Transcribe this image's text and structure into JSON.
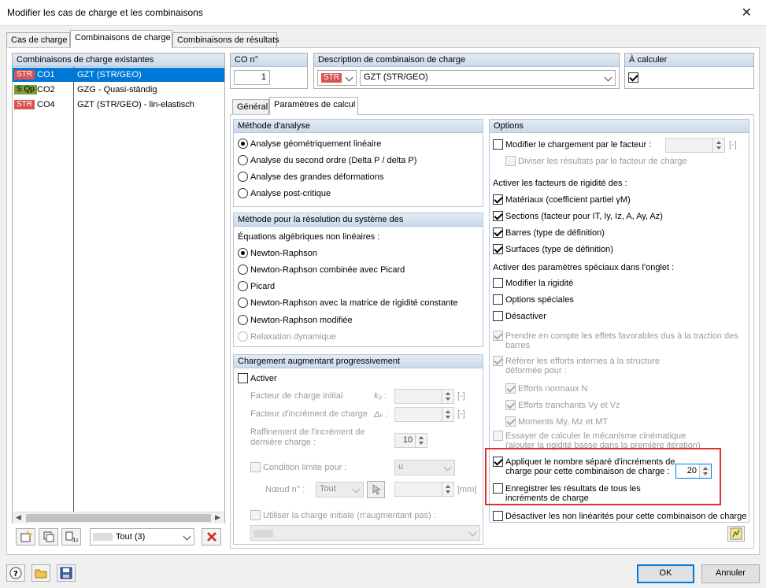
{
  "window": {
    "title": "Modifier les cas de charge et les combinaisons",
    "close": "✕"
  },
  "tabs": [
    "Cas de charge",
    "Combinaisons de charge",
    "Combinaisons de résultats"
  ],
  "colors": {
    "str": "#d9534f",
    "sqp": "#7a9a3a",
    "accent": "#0078d7",
    "highlight": "#e03030"
  },
  "left": {
    "header": "Combinaisons de charge existantes",
    "items": [
      {
        "tag": "STR",
        "id": "CO1",
        "desc": "GZT (STR/GEO)"
      },
      {
        "tag": "S Qp",
        "id": "CO2",
        "desc": "GZG - Quasi-ständig"
      },
      {
        "tag": "STR",
        "id": "CO4",
        "desc": "GZT (STR/GEO) - lin-elastisch"
      }
    ],
    "filter": "Tout (3)"
  },
  "co": {
    "label": "CO n°",
    "value": "1"
  },
  "description": {
    "label": "Description de combinaison de charge",
    "tag": "STR",
    "value": "GZT (STR/GEO)"
  },
  "calc": {
    "label": "À calculer"
  },
  "subtabs": [
    "Général",
    "Paramètres de calcul"
  ],
  "methode": {
    "header": "Méthode d'analyse",
    "options": [
      "Analyse géométriquement linéaire",
      "Analyse du second ordre (Delta P / delta P)",
      "Analyse des grandes déformations",
      "Analyse post-critique"
    ]
  },
  "resolution": {
    "header": "Méthode pour la résolution du système des",
    "sub": "Équations algébriques non linéaires :",
    "options": [
      "Newton-Raphson",
      "Newton-Raphson combinée avec Picard",
      "Picard",
      "Newton-Raphson avec la matrice de rigidité constante",
      "Newton-Raphson modifiée",
      "Relaxation dynamique"
    ]
  },
  "chargement": {
    "header": "Chargement augmentant progressivement",
    "activer": "Activer",
    "facteur_initial": "Facteur de charge initial",
    "k0": "k₀ :",
    "facteur_increment": "Facteur d'incrément de charge",
    "dk": "Δₖ :",
    "raffinement": "Raffinement de l'incrément de",
    "derniere": "dernière charge :",
    "raffinement_value": "10",
    "unit": "[-]",
    "condition": "Condition limite pour :",
    "condition_value": "u",
    "noeud": "Nœud n° :",
    "noeud_value": "Tout",
    "mm": "[mm]",
    "utiliser": "Utiliser la charge initiale (n'augmentant pas) :"
  },
  "options": {
    "header": "Options",
    "modifier": "Modifier le chargement par le facteur :",
    "unit": "[-]",
    "diviser": "Diviser les résultats par le facteur de charge",
    "activer_rigidite": "Activer les facteurs de rigidité des :",
    "materiaux": "Matériaux (coefficient partiel γM)",
    "sections": "Sections (facteur pour IT, Iy, Iz, A, Ay, Az)",
    "barres": "Barres (type de définition)",
    "surfaces": "Surfaces (type de définition)",
    "activer_speciaux": "Activer des paramètres spéciaux dans l'onglet :",
    "modifier_rigidite": "Modifier la rigidité",
    "options_speciales": "Options spéciales",
    "desactiver": "Désactiver",
    "prendre1": "Prendre en compte les effets favorables dus à la traction des",
    "prendre2": "barres",
    "referer1": "Référer les efforts internes à la structure",
    "referer2": "déformée pour :",
    "efforts_normaux": "Efforts normaux N",
    "efforts_tranchants": "Efforts tranchants Vy et Vz",
    "moments": "Moments My, Mz et MT",
    "essayer1": "Essayer de calculer le mécanisme cinématique",
    "essayer2": "(ajouter la rigidité basse dans la première itération)",
    "appliquer1": "Appliquer le nombre séparé d'incréments de",
    "appliquer2": "charge pour cette combinaison de charge :",
    "appliquer_value": "20",
    "enregistrer1": "Enregistrer les résultats de tous les",
    "enregistrer2": "incréments de charge",
    "desactiver_nl": "Désactiver les non linéarités pour cette combinaison de charge"
  },
  "buttons": {
    "ok": "OK",
    "annuler": "Annuler"
  }
}
